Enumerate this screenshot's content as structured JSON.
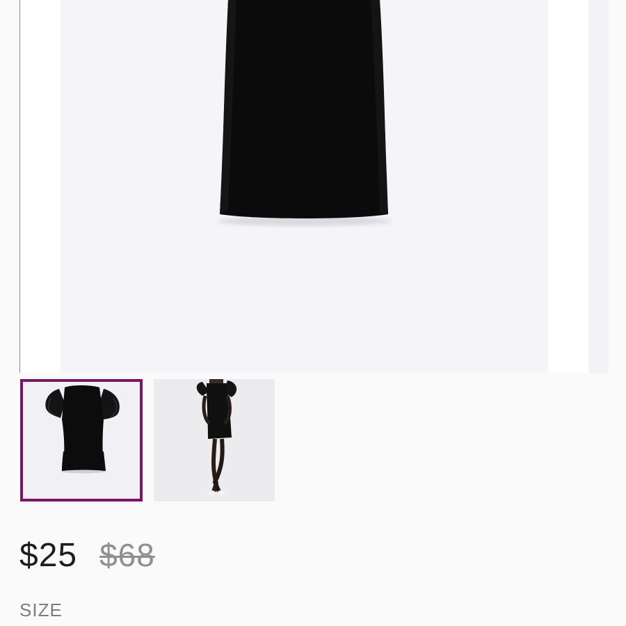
{
  "product": {
    "main_image": {
      "icon": "black-dress-product-photo"
    },
    "thumbnails": [
      {
        "icon": "dress-flat-lay-thumbnail",
        "selected": true,
        "selected_border_color": "#7a1566"
      },
      {
        "icon": "dress-on-model-thumbnail",
        "selected": false
      }
    ],
    "price": {
      "current": "$25",
      "original": "$68"
    },
    "size": {
      "label": "SIZE"
    }
  },
  "colors": {
    "background": "#fbfafb",
    "image_background": "#f4f4f9",
    "dress": "#0a0a0a",
    "price_text": "#1d1d1f",
    "original_price_text": "#8f8f91",
    "size_label": "#7d7d80",
    "thumb_selected_border": "#7a1566"
  }
}
